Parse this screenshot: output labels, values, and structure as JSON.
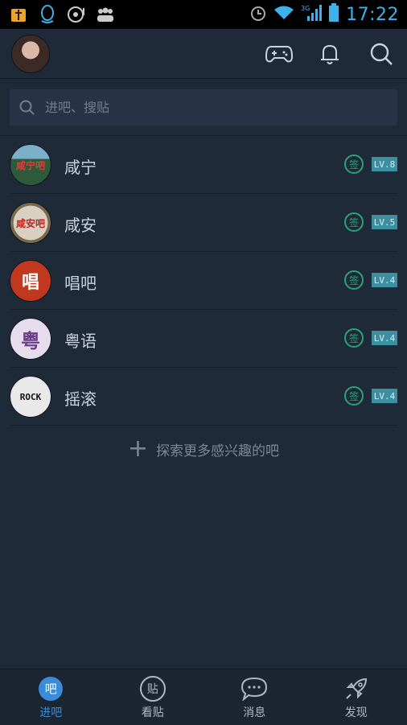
{
  "status_bar": {
    "time": "17:22",
    "network": "3G"
  },
  "header": {
    "avatar_alt": ""
  },
  "search": {
    "placeholder": "进吧、搜贴"
  },
  "forums": [
    {
      "name": "咸宁",
      "level": "LV.8",
      "sign": "签",
      "icon_text": "咸宁吧",
      "color": "#2d5a3a"
    },
    {
      "name": "咸安",
      "level": "LV.5",
      "sign": "签",
      "icon_text": "咸安吧",
      "color": "#c8c0b0"
    },
    {
      "name": "唱吧",
      "level": "LV.4",
      "sign": "签",
      "icon_text": "唱",
      "color": "#c0391f"
    },
    {
      "name": "粤语",
      "level": "LV.4",
      "sign": "签",
      "icon_text": "粤",
      "color": "#8c5ea6"
    },
    {
      "name": "摇滚",
      "level": "LV.4",
      "sign": "签",
      "icon_text": "ROCK",
      "color": "#222222"
    }
  ],
  "explore": {
    "label": "探索更多感兴趣的吧"
  },
  "tabs": [
    {
      "label": "进吧",
      "icon": "吧"
    },
    {
      "label": "看贴",
      "icon": "贴"
    },
    {
      "label": "消息",
      "icon": "chat-icon"
    },
    {
      "label": "发现",
      "icon": "rocket-icon"
    }
  ],
  "colors": {
    "accent": "#3a8bd8",
    "sign": "#2aa37a",
    "level": "#3b8fa1"
  }
}
